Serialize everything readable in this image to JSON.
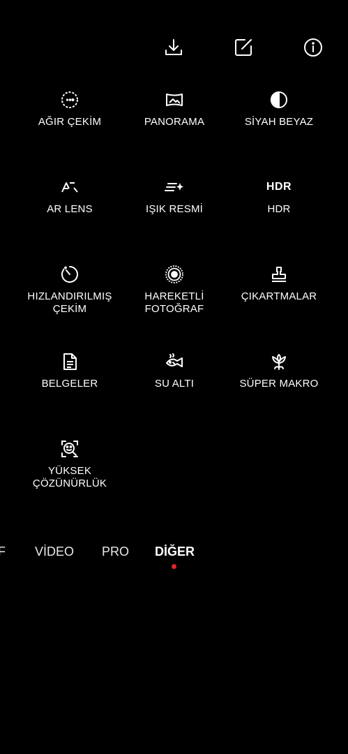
{
  "top_bar": {
    "icons": [
      "download-icon",
      "edit-icon",
      "info-icon"
    ]
  },
  "modes": [
    {
      "label": "AĞIR ÇEKİM",
      "icon": "slow-motion-icon"
    },
    {
      "label": "PANORAMA",
      "icon": "panorama-icon"
    },
    {
      "label": "SİYAH BEYAZ",
      "icon": "black-white-icon"
    },
    {
      "label": "AR LENS",
      "icon": "ar-lens-icon",
      "glyph": "AR"
    },
    {
      "label": "IŞIK RESMİ",
      "icon": "light-painting-icon"
    },
    {
      "label": "HDR",
      "icon": "hdr-icon",
      "glyph": "HDR"
    },
    {
      "label": "HIZLANDIRILMIŞ\nÇEKİM",
      "icon": "time-lapse-icon"
    },
    {
      "label": "HAREKETLİ\nFOTOĞRAF",
      "icon": "moving-picture-icon"
    },
    {
      "label": "ÇIKARTMALAR",
      "icon": "stickers-icon"
    },
    {
      "label": "BELGELER",
      "icon": "documents-icon"
    },
    {
      "label": "SU ALTI",
      "icon": "underwater-icon"
    },
    {
      "label": "SÜPER MAKRO",
      "icon": "super-macro-icon"
    },
    {
      "label": "YÜKSEK\nÇÖZÜNÜRLÜK",
      "icon": "high-resolution-icon"
    }
  ],
  "tabs": {
    "partial": "F",
    "video": "VİDEO",
    "pro": "PRO",
    "more": "DİĞER",
    "active": "more"
  },
  "colors": {
    "background": "#000000",
    "text": "#ffffff",
    "active_indicator": "#e0242b"
  }
}
